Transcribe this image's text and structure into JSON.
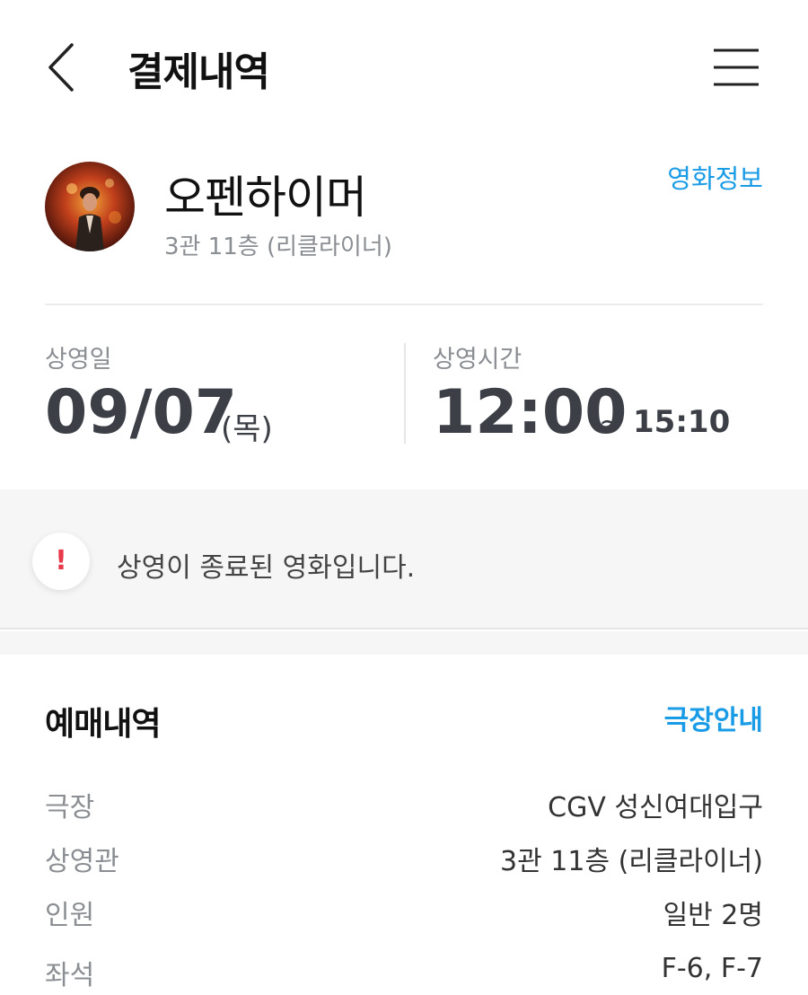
{
  "header": {
    "title": "결제내역",
    "back_icon": "chevron-left-icon",
    "menu_icon": "hamburger-menu-icon"
  },
  "movie": {
    "title": "오펜하이머",
    "hall": "3관 11층 (리클라이너)",
    "info_link": "영화정보"
  },
  "schedule": {
    "date_label": "상영일",
    "date": "09/07",
    "day": "(목)",
    "time_label": "상영시간",
    "start": "12:00",
    "tilde": "~",
    "end": "15:10"
  },
  "notice": {
    "icon": "!",
    "text": "상영이 종료된 영화입니다."
  },
  "booking": {
    "title": "예매내역",
    "theater_link": "극장안내",
    "rows": [
      {
        "label": "극장",
        "value": "CGV 성신여대입구"
      },
      {
        "label": "상영관",
        "value": "3관 11층 (리클라이너)"
      },
      {
        "label": "인원",
        "value": "일반 2명"
      },
      {
        "label": "좌석",
        "value": "F-6, F-7"
      }
    ]
  },
  "colors": {
    "accent": "#1a9be6",
    "alert": "#e8394a",
    "text_dark": "#3c4046",
    "text_muted": "#8a8d92"
  }
}
